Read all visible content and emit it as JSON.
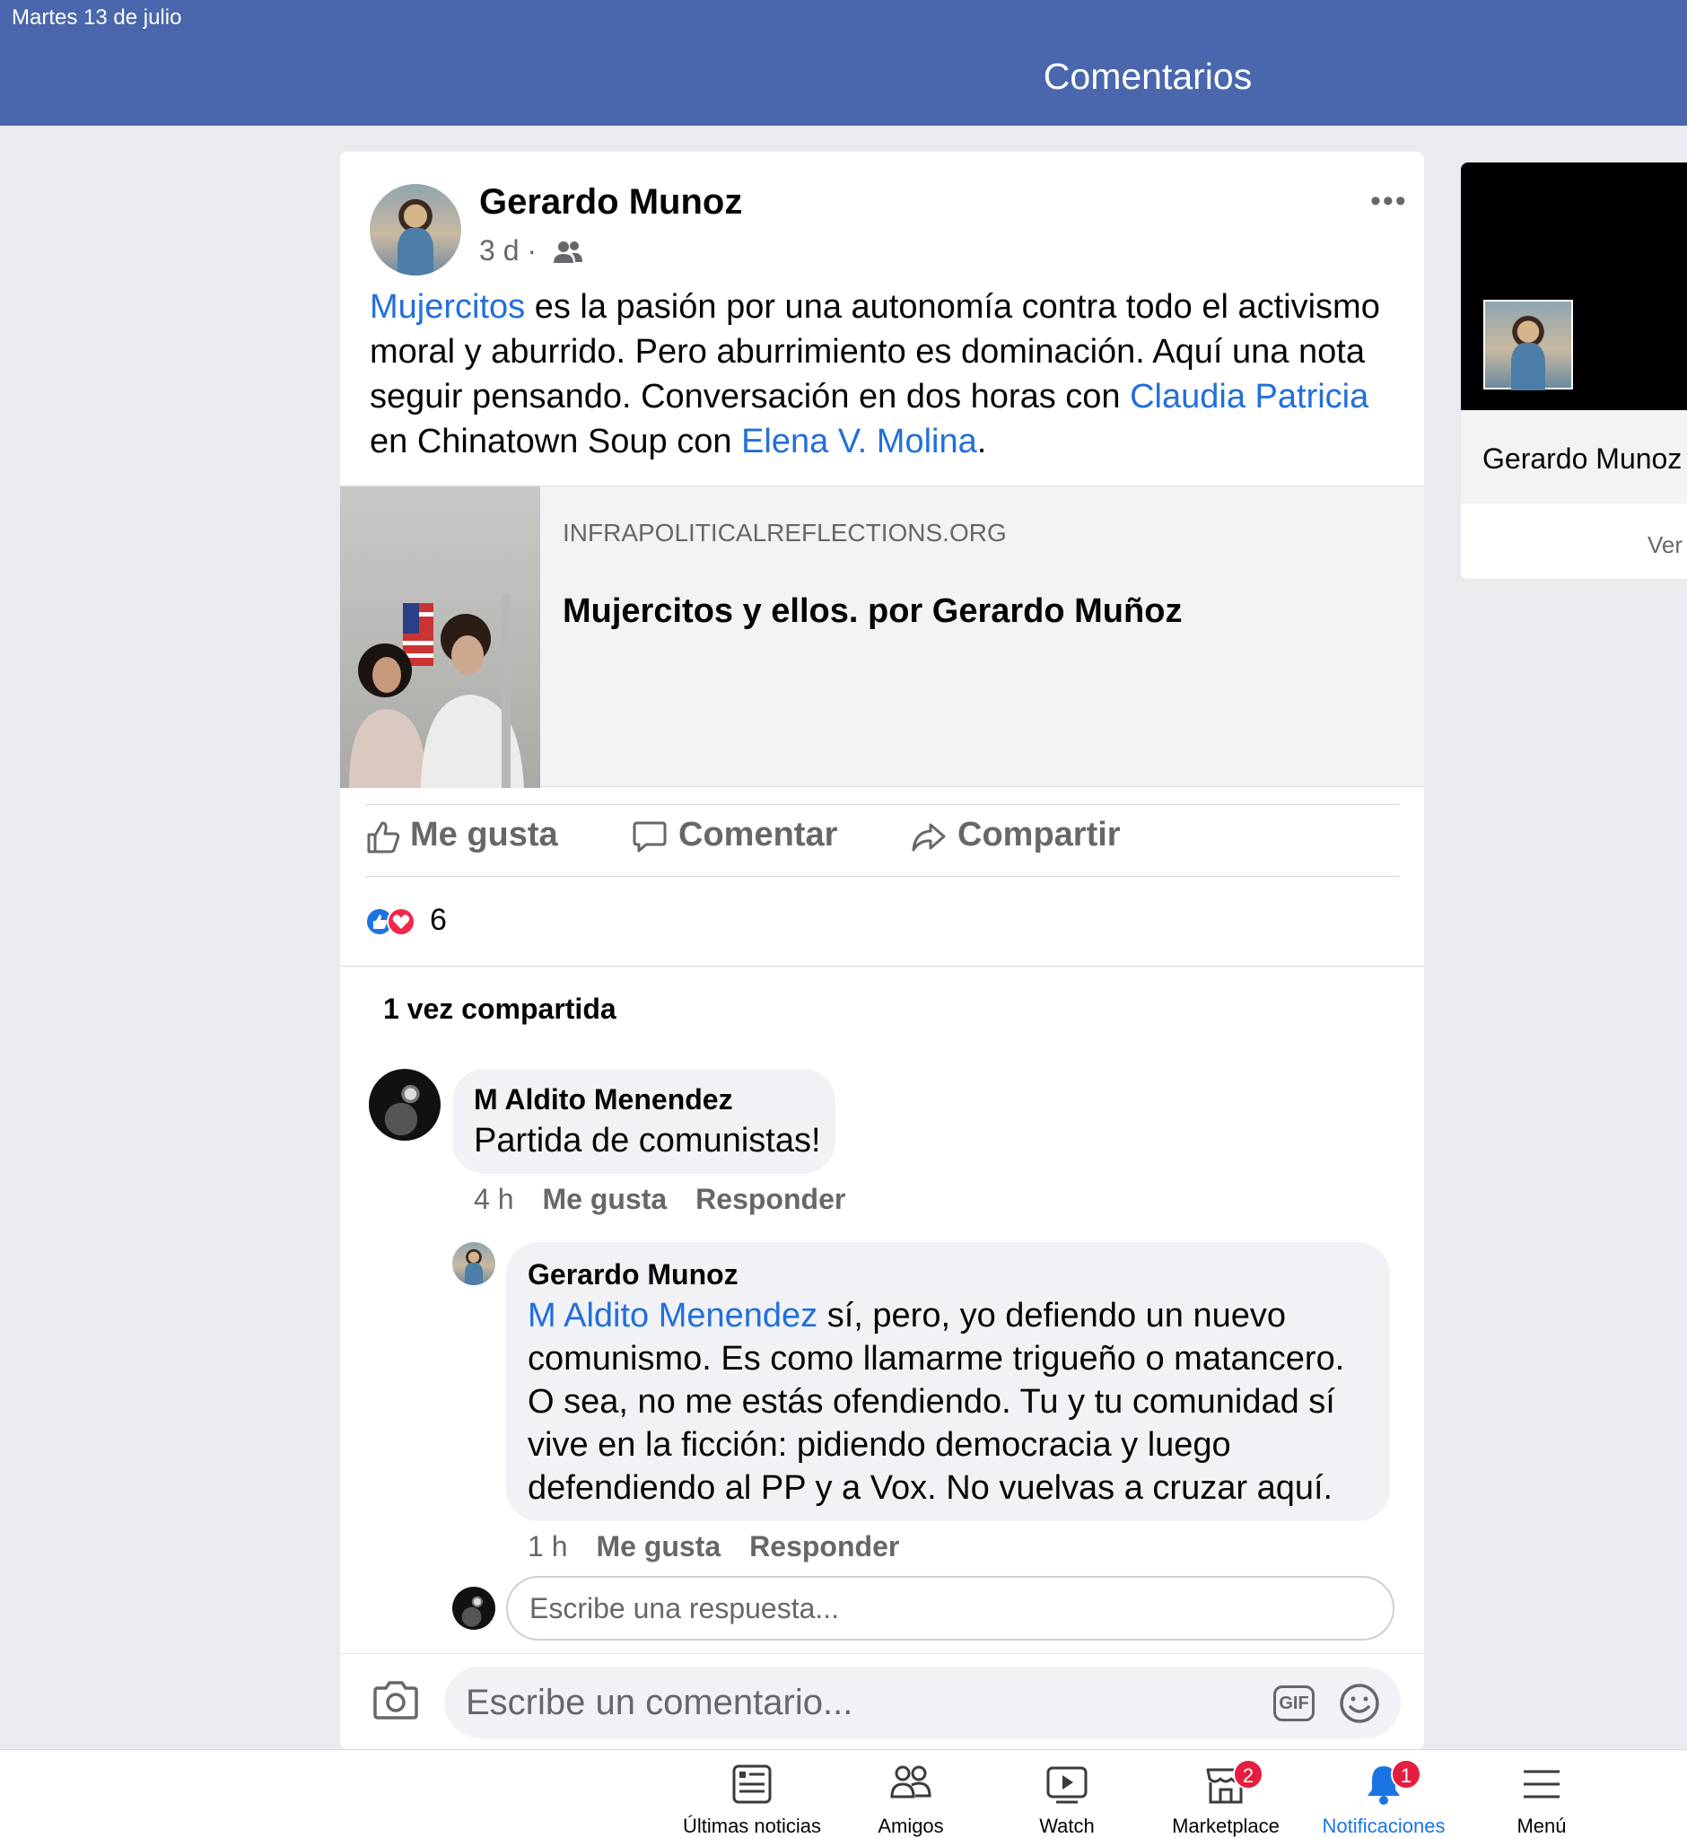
{
  "status_bar": {
    "date": "Martes 13 de julio"
  },
  "header": {
    "title": "Comentarios"
  },
  "post": {
    "author": "Gerardo Munoz",
    "time": "3 d ·",
    "more_icon": "ellipsis-icon",
    "text": {
      "link1": "Mujercitos",
      "part1": " es la pasión por una autonomía contra todo el activismo moral y aburrido. Pero aburrimiento es dominación. Aquí una nota seguir pensando. Conversación en dos horas con ",
      "link2": "Claudia Patricia",
      "part2": " en Chinatown Soup con ",
      "link3": "Elena V. Molina",
      "part3": "."
    },
    "link_preview": {
      "domain": "INFRAPOLITICALREFLECTIONS.ORG",
      "title": "Mujercitos y ellos. por Gerardo Muñoz"
    },
    "actions": {
      "like": "Me gusta",
      "comment": "Comentar",
      "share": "Compartir"
    },
    "reactions_count": "6",
    "shares": "1 vez compartida"
  },
  "comments": [
    {
      "author": "M Aldito Menendez",
      "text": "Partida de comunistas!",
      "time": "4 h",
      "like": "Me gusta",
      "reply": "Responder"
    },
    {
      "author": "Gerardo Munoz",
      "mention": "M Aldito Menendez",
      "text": " sí, pero, yo defiendo un nuevo comunismo. Es como llamarme trigueño o matancero. O sea, no me estás ofendiendo. Tu y tu comunidad sí vive en la ficción: pidiendo democracia y luego defendiendo al PP y a Vox. No vuelvas a cruzar aquí.",
      "time": "1 h",
      "like": "Me gusta",
      "reply": "Responder"
    }
  ],
  "reply_input": {
    "placeholder": "Escribe una respuesta..."
  },
  "composer": {
    "placeholder": "Escribe un comentario...",
    "gif": "GIF"
  },
  "side_card": {
    "name": "Gerardo Munoz",
    "action": "Ver"
  },
  "tabbar": {
    "tabs": [
      {
        "label": "Últimas noticias",
        "icon": "news-feed-icon"
      },
      {
        "label": "Amigos",
        "icon": "friends-icon"
      },
      {
        "label": "Watch",
        "icon": "watch-icon"
      },
      {
        "label": "Marketplace",
        "icon": "marketplace-icon",
        "badge": "2"
      },
      {
        "label": "Notificaciones",
        "icon": "bell-icon",
        "badge": "1",
        "active": true
      },
      {
        "label": "Menú",
        "icon": "menu-icon"
      }
    ]
  },
  "colors": {
    "header": "#4a67ad",
    "link": "#216fdb",
    "active_tab": "#1b74e4",
    "badge": "#e41e3f"
  }
}
